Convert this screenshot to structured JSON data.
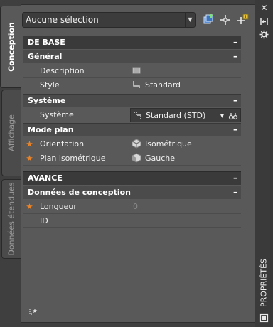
{
  "tabs": [
    {
      "label": "Conception",
      "active": true
    },
    {
      "label": "Affichage",
      "active": false
    },
    {
      "label": "Données étendues",
      "active": false
    }
  ],
  "toolbar": {
    "selection_value": "Aucune sélection",
    "icons": [
      "quick-select-icon",
      "select-objects-icon",
      "toggle-pickadd-icon"
    ]
  },
  "palette": {
    "title": "PROPRIÉTÉS",
    "right_icons": [
      "close-icon",
      "autohide-icon",
      "palette-properties-icon",
      "palette-menu-icon"
    ]
  },
  "sections": {
    "base": {
      "title": "DE BASE",
      "toggle": "–"
    },
    "general": {
      "title": "Général",
      "toggle": "–"
    },
    "description": {
      "label": "Description",
      "icon": "description-icon"
    },
    "style": {
      "label": "Style",
      "value": "Standard",
      "icon": "style-icon"
    },
    "systeme_group": {
      "title": "Système",
      "toggle": "–"
    },
    "systeme": {
      "label": "Système",
      "value": "Standard (STD)",
      "icon": "system-icon"
    },
    "mode_plan": {
      "title": "Mode plan",
      "toggle": "–"
    },
    "orientation": {
      "label": "Orientation",
      "value": "Isométrique",
      "icon": "isometric-icon"
    },
    "plan_iso": {
      "label": "Plan isométrique",
      "value": "Gauche",
      "icon": "iso-plane-icon"
    },
    "avance": {
      "title": "AVANCE",
      "toggle": "–"
    },
    "donnees_conception": {
      "title": "Données de conception",
      "toggle": "–"
    },
    "longueur": {
      "label": "Longueur",
      "value": "0"
    },
    "id": {
      "label": "ID",
      "value": ""
    }
  },
  "colors": {
    "panel_bg": "#595959",
    "header_bg": "#3a3a3a",
    "subheader_bg": "#4b4b4b",
    "accent_star": "#e8832a",
    "text": "#f0f0f0"
  }
}
